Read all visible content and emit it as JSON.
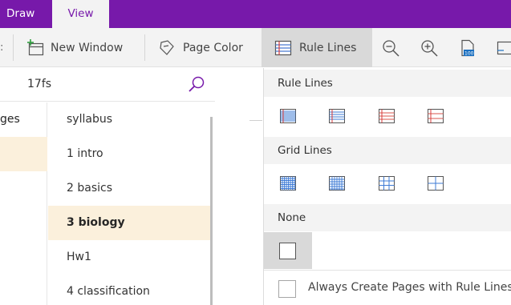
{
  "tabs": {
    "draw": "Draw",
    "view": "View"
  },
  "ribbon": {
    "new_window": "New Window",
    "page_color": "Page Color",
    "rule_lines": "Rule Lines"
  },
  "search": {
    "text": "17fs"
  },
  "sections": {
    "pages_label": "ges"
  },
  "pages": [
    "syllabus",
    "1 intro",
    "2 basics",
    "3 biology",
    "Hw1",
    "4 classification"
  ],
  "dropdown": {
    "rule_lines_header": "Rule Lines",
    "grid_lines_header": "Grid Lines",
    "none_header": "None",
    "always_label": "Always Create Pages with Rule Lines"
  },
  "colors": {
    "accent": "#7719aa",
    "highlight": "#fbf0dc"
  }
}
